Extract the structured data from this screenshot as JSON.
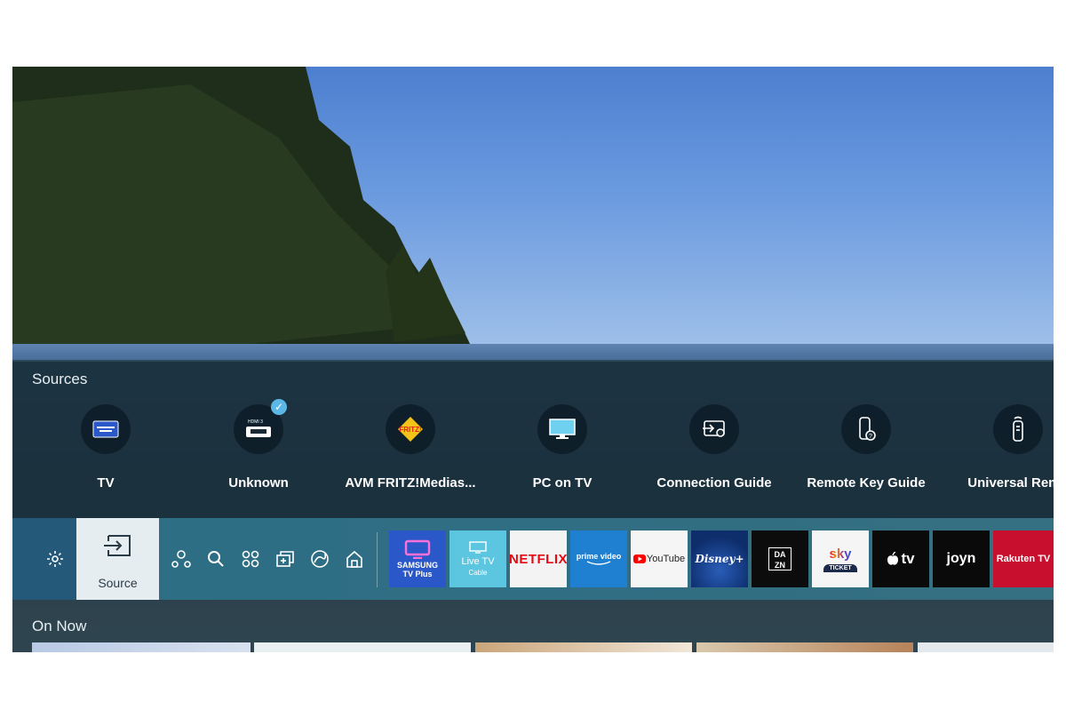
{
  "sources": {
    "title": "Sources",
    "items": [
      {
        "label": "TV",
        "icon": "samsung-tv-plus-icon"
      },
      {
        "label": "Unknown",
        "icon": "hdmi-icon",
        "badge": "HDMI 3",
        "selected": true
      },
      {
        "label": "AVM FRITZ!Medias...",
        "icon": "fritz-icon",
        "icon_text": "FRITZ!"
      },
      {
        "label": "PC on TV",
        "icon": "monitor-icon"
      },
      {
        "label": "Connection Guide",
        "icon": "connection-guide-icon"
      },
      {
        "label": "Remote Key Guide",
        "icon": "remote-key-guide-icon"
      },
      {
        "label": "Universal Remo",
        "icon": "universal-remote-icon"
      }
    ]
  },
  "launcher": {
    "source_label": "Source",
    "icons": [
      "settings-icon",
      "source-icon",
      "people-icon",
      "search-icon",
      "apps-icon",
      "multi-view-icon",
      "ambient-icon",
      "home-icon"
    ],
    "apps": [
      {
        "name": "samsung-tv-plus",
        "line1": "SAMSUNG",
        "line2": "TV Plus",
        "bg": "#2b58c9"
      },
      {
        "name": "live-tv",
        "line1": "Live TV",
        "line2": "Cable",
        "bg": "#5cc6e0"
      },
      {
        "name": "netflix",
        "line1": "NETFLIX",
        "bg": "#f3f3f3",
        "fg": "#e50914"
      },
      {
        "name": "prime-video",
        "line1": "prime video",
        "bg": "#1f7fd1"
      },
      {
        "name": "youtube",
        "line1": "YouTube",
        "bg": "#f5f5f5"
      },
      {
        "name": "disney-plus",
        "line1": "Disney+",
        "bg": "#0d2d6b"
      },
      {
        "name": "dazn",
        "line1": "DA ZN",
        "bg": "#0c0c0c"
      },
      {
        "name": "sky-ticket",
        "line1": "sky",
        "line2": "TICKET",
        "bg": "#f5f5f5"
      },
      {
        "name": "apple-tv",
        "line1": "tv",
        "bg": "#0a0a0a"
      },
      {
        "name": "joyn",
        "line1": "joyn",
        "bg": "#0a0a0a"
      },
      {
        "name": "rakuten-tv",
        "line1": "Rakuten TV",
        "bg": "#c8102e"
      }
    ]
  },
  "on_now": {
    "title": "On Now"
  }
}
